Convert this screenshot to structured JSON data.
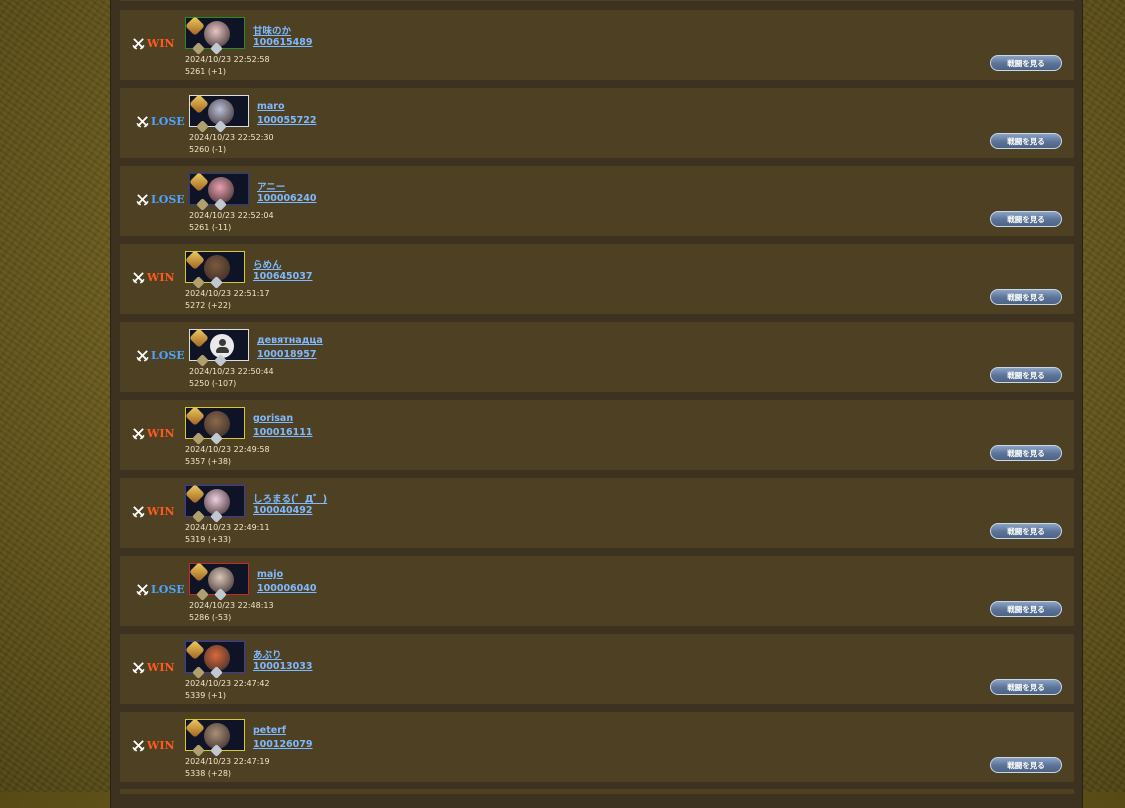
{
  "history": {
    "watch_label": "戦闘を見る",
    "rows": [
      {
        "result": "WIN",
        "name": "甘味のか",
        "id": "100615489",
        "datetime": "2024/10/23 22:52:58",
        "rating": "5261 (+1)",
        "frame_color": "#2a8a2a",
        "face_color": "#e8c6c6"
      },
      {
        "result": "LOSE",
        "name": "maro",
        "id": "100055722",
        "datetime": "2024/10/23 22:52:30",
        "rating": "5260 (-1)",
        "frame_color": "#dddddd",
        "face_color": "#b8c0d8"
      },
      {
        "result": "LOSE",
        "name": "アニー",
        "id": "100006240",
        "datetime": "2024/10/23 22:52:04",
        "rating": "5261 (-11)",
        "frame_color": "#2a3a8a",
        "face_color": "#e8a0b0"
      },
      {
        "result": "WIN",
        "name": "らめん",
        "id": "100645037",
        "datetime": "2024/10/23 22:51:17",
        "rating": "5272 (+22)",
        "frame_color": "#d8c838",
        "face_color": "#7a5a3a"
      },
      {
        "result": "LOSE",
        "name": "девятнадца",
        "id": "100018957",
        "datetime": "2024/10/23 22:50:44",
        "rating": "5250 (-107)",
        "frame_color": "#dddddd",
        "face_color": ""
      },
      {
        "result": "WIN",
        "name": "gorisan",
        "id": "100016111",
        "datetime": "2024/10/23 22:49:58",
        "rating": "5357 (+38)",
        "frame_color": "#d8c838",
        "face_color": "#8a6a4a"
      },
      {
        "result": "WIN",
        "name": "しろまる(゜Д゜)",
        "id": "100040492",
        "datetime": "2024/10/23 22:49:11",
        "rating": "5319 (+33)",
        "frame_color": "#3a3aa8",
        "face_color": "#f0d0e0"
      },
      {
        "result": "LOSE",
        "name": "majo",
        "id": "100006040",
        "datetime": "2024/10/23 22:48:13",
        "rating": "5286 (-53)",
        "frame_color": "#c82828",
        "face_color": "#d8c8b8"
      },
      {
        "result": "WIN",
        "name": "あぶり",
        "id": "100013033",
        "datetime": "2024/10/23 22:47:42",
        "rating": "5339 (+1)",
        "frame_color": "#3a3aa8",
        "face_color": "#d86a3a"
      },
      {
        "result": "WIN",
        "name": "peterf",
        "id": "100126079",
        "datetime": "2024/10/23 22:47:19",
        "rating": "5338 (+28)",
        "frame_color": "#d8c838",
        "face_color": "#a89078"
      }
    ]
  },
  "icons": {
    "result": "crossed-swords-icon",
    "default_avatar": "user-silhouette-icon"
  },
  "colors": {
    "win": "#ff5a1e",
    "lose": "#4da3ff",
    "link": "#7fb9ff"
  }
}
